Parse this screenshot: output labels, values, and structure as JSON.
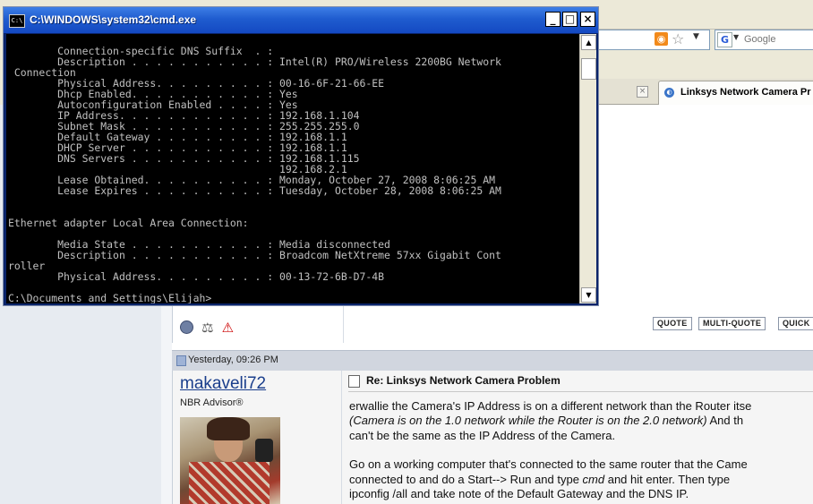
{
  "browser": {
    "search_placeholder": "Google",
    "active_tab_label": "Linksys Network Camera Pr",
    "google_icon_letter": "G"
  },
  "post1": {
    "buttons": [
      "QUOTE",
      "MULTI-QUOTE",
      "QUICK"
    ]
  },
  "post2": {
    "date": "Yesterday, 09:26 PM",
    "username": "makaveli72",
    "usertitle": "NBR Advisor®",
    "title": "Re: Linksys Network Camera Problem",
    "lines": [
      [
        {
          "t": "erwallie the Camera's IP Address is on a different network than the Router itse",
          "i": false
        }
      ],
      [
        {
          "t": "(Camera is on the 1.0 network while the Router is on the 2.0 network)",
          "i": true
        },
        {
          "t": " And th",
          "i": false
        }
      ],
      [
        {
          "t": "can't be the same as the IP Address of the Camera.",
          "i": false
        }
      ],
      [],
      [
        {
          "t": "Go on a working computer that's connected to the same router that the Came",
          "i": false
        }
      ],
      [
        {
          "t": "connected to and do a Start--> Run and type ",
          "i": false
        },
        {
          "t": "cmd",
          "i": true
        },
        {
          "t": " and hit enter. Then type",
          "i": false
        }
      ],
      [
        {
          "t": "ipconfig /all and take note of the Default Gateway and the DNS IP.",
          "i": false
        }
      ]
    ]
  },
  "cmd": {
    "title": "C:\\WINDOWS\\system32\\cmd.exe",
    "icon_text": "C:\\",
    "minimize": "_",
    "maximize": "□",
    "close": "×",
    "scroll_up": "▲",
    "scroll_down": "▼",
    "output": "        Connection-specific DNS Suffix  . :\n        Description . . . . . . . . . . . : Intel(R) PRO/Wireless 2200BG Network\n Connection\n        Physical Address. . . . . . . . . : 00-16-6F-21-66-EE\n        Dhcp Enabled. . . . . . . . . . . : Yes\n        Autoconfiguration Enabled . . . . : Yes\n        IP Address. . . . . . . . . . . . : 192.168.1.104\n        Subnet Mask . . . . . . . . . . . : 255.255.255.0\n        Default Gateway . . . . . . . . . : 192.168.1.1\n        DHCP Server . . . . . . . . . . . : 192.168.1.1\n        DNS Servers . . . . . . . . . . . : 192.168.1.115\n                                            192.168.2.1\n        Lease Obtained. . . . . . . . . . : Monday, October 27, 2008 8:06:25 AM\n        Lease Expires . . . . . . . . . . : Tuesday, October 28, 2008 8:06:25 AM\n\n\nEthernet adapter Local Area Connection:\n\n        Media State . . . . . . . . . . . : Media disconnected\n        Description . . . . . . . . . . . : Broadcom NetXtreme 57xx Gigabit Cont\nroller\n        Physical Address. . . . . . . . . : 00-13-72-6B-D7-4B\n\nC:\\Documents and Settings\\Elijah>"
  }
}
